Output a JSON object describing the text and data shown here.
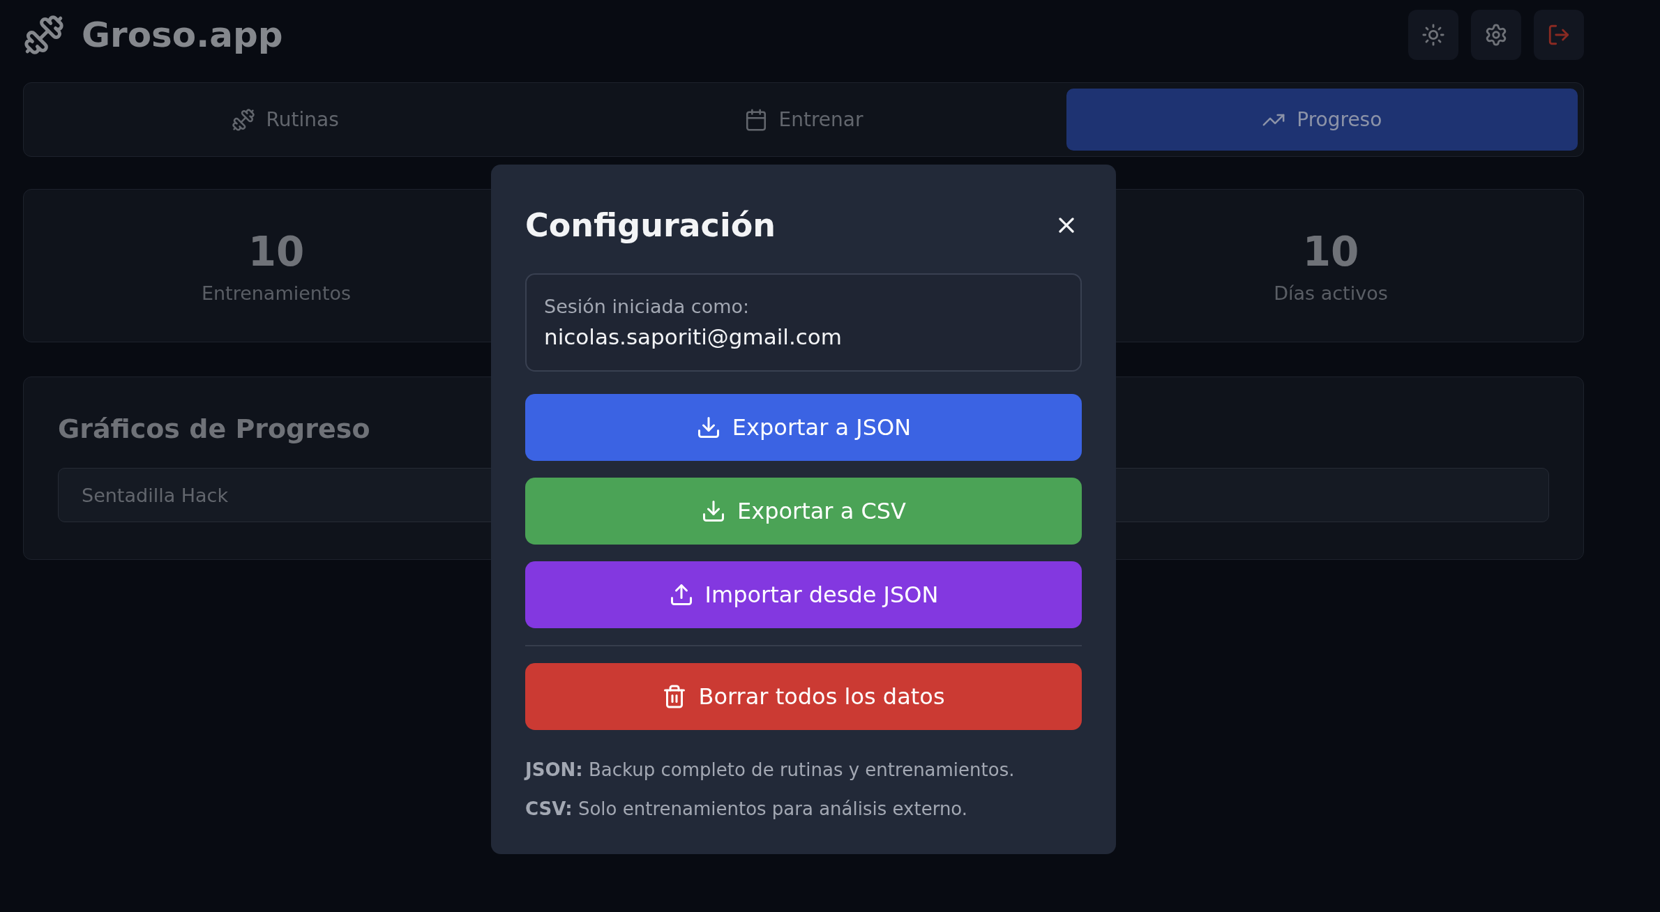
{
  "app": {
    "title": "Groso.app"
  },
  "tabs": [
    {
      "label": "Rutinas",
      "kind": "dumbbell",
      "selected": false
    },
    {
      "label": "Entrenar",
      "kind": "calendar",
      "selected": false
    },
    {
      "label": "Progreso",
      "kind": "trend",
      "selected": true
    }
  ],
  "stats": [
    {
      "value": "10",
      "label": "Entrenamientos"
    },
    {
      "value": "10",
      "label": "Días activos"
    }
  ],
  "progress": {
    "title": "Gráficos de Progreso",
    "select": {
      "value": "Sentadilla Hack"
    }
  },
  "dialog": {
    "title": "Configuración",
    "session": {
      "label": "Sesión iniciada como:",
      "email": "nicolas.saporiti@gmail.com"
    },
    "actions": [
      {
        "label": "Exportar a JSON",
        "kind": "download",
        "color": "#3b63e3"
      },
      {
        "label": "Exportar a CSV",
        "kind": "download",
        "color": "#4ba356"
      },
      {
        "label": "Importar desde JSON",
        "kind": "upload",
        "color": "#8338e0"
      },
      {
        "label": "Borrar todos los datos",
        "kind": "delete",
        "color": "#cb3a33"
      }
    ],
    "notes": [
      "**JSON:** Backup completo de rutinas y entrenamientos.",
      "**CSV:** Solo entrenamientos para análisis externo."
    ]
  }
}
